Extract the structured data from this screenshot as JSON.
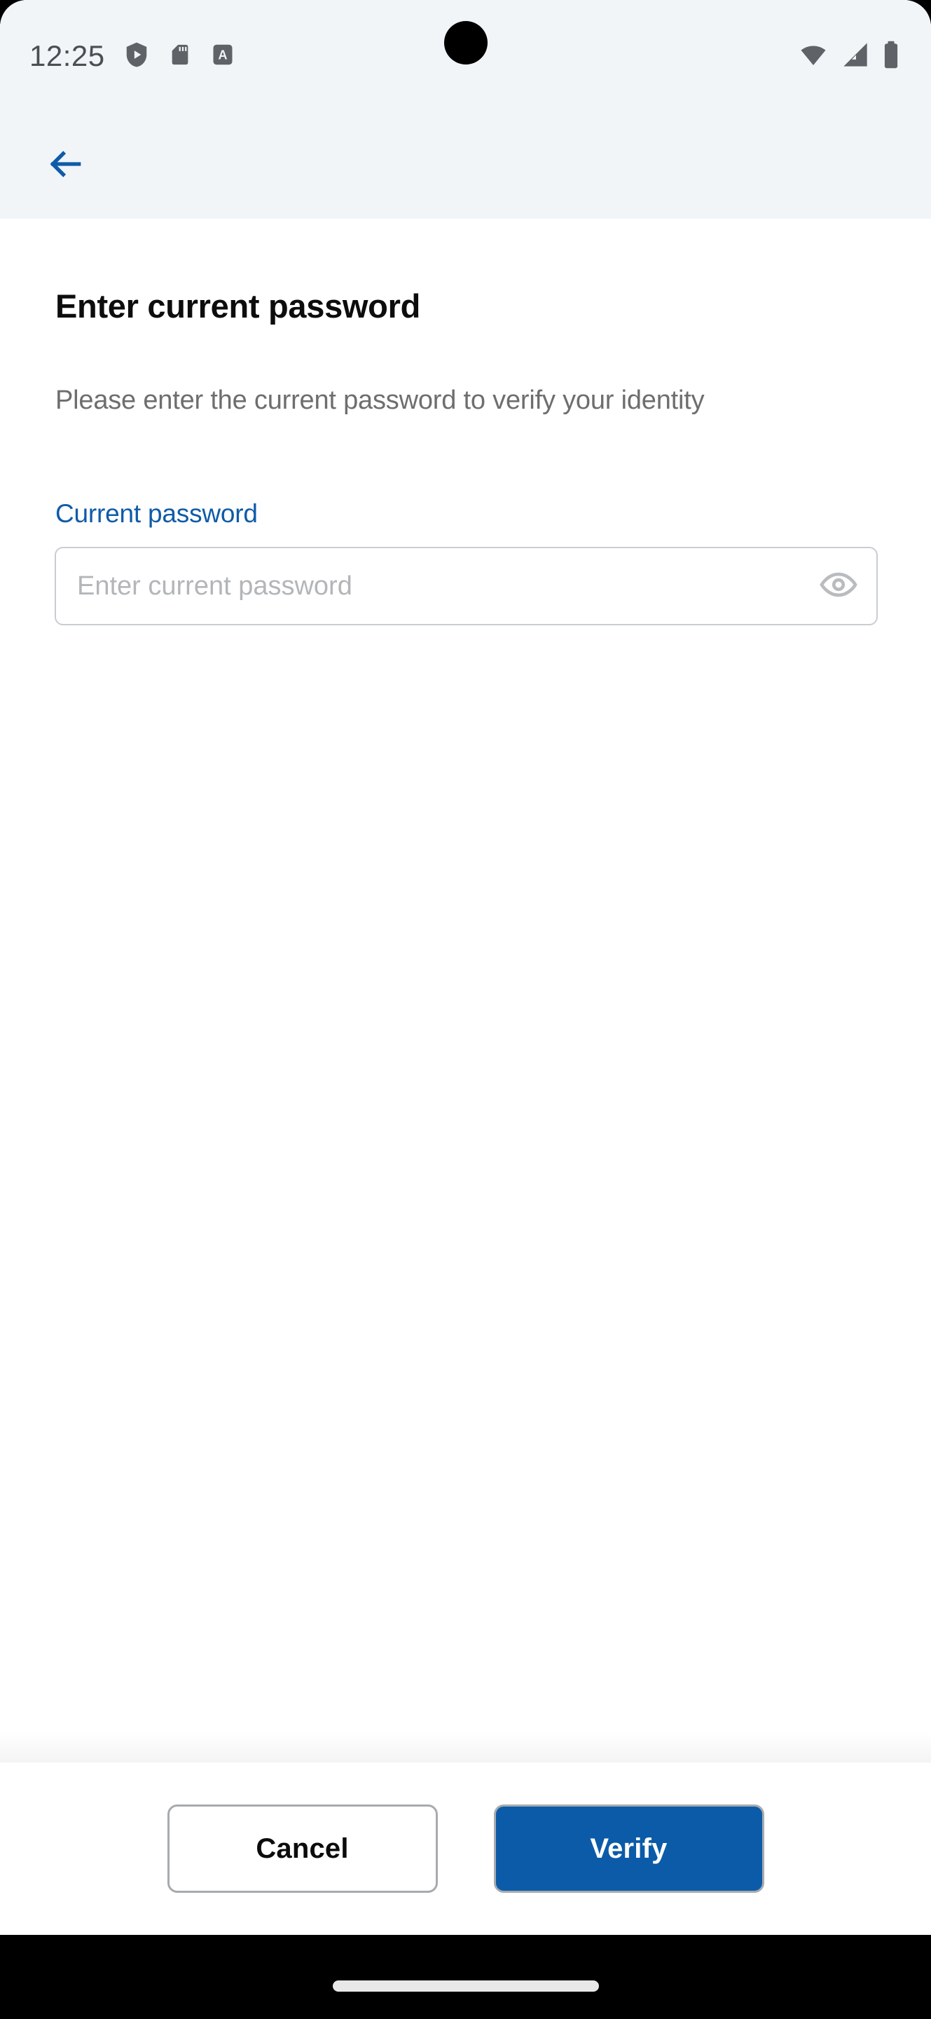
{
  "status_bar": {
    "clock": "12:25",
    "left_icons": [
      "play-protect-icon",
      "sd-card-icon",
      "letter-a-badge-icon"
    ],
    "right_icons": [
      "wifi-icon",
      "cellular-signal-icon",
      "battery-icon"
    ],
    "background_color": "#f1f5f8",
    "text_color": "#4a4f54"
  },
  "app_bar": {
    "back_icon": "arrow-left-icon",
    "accent_color": "#0f5ba8",
    "background_color": "#f1f5f8"
  },
  "screen": {
    "title": "Enter current password",
    "subtitle": "Please enter the current password to verify your identity"
  },
  "password_field": {
    "label": "Current password",
    "value": "",
    "placeholder": "Enter current password",
    "label_color": "#0f5ba8",
    "border_color": "#c9cdd1",
    "toggle_icon": "eye-visibility-icon",
    "toggle_icon_color": "#b9bcbf"
  },
  "actions": {
    "cancel_label": "Cancel",
    "verify_label": "Verify",
    "primary_color": "#0b5ba8",
    "border_color": "#a7abaf"
  },
  "nav_bar": {
    "handle": "gesture-home-handle",
    "background_color": "#000000"
  }
}
